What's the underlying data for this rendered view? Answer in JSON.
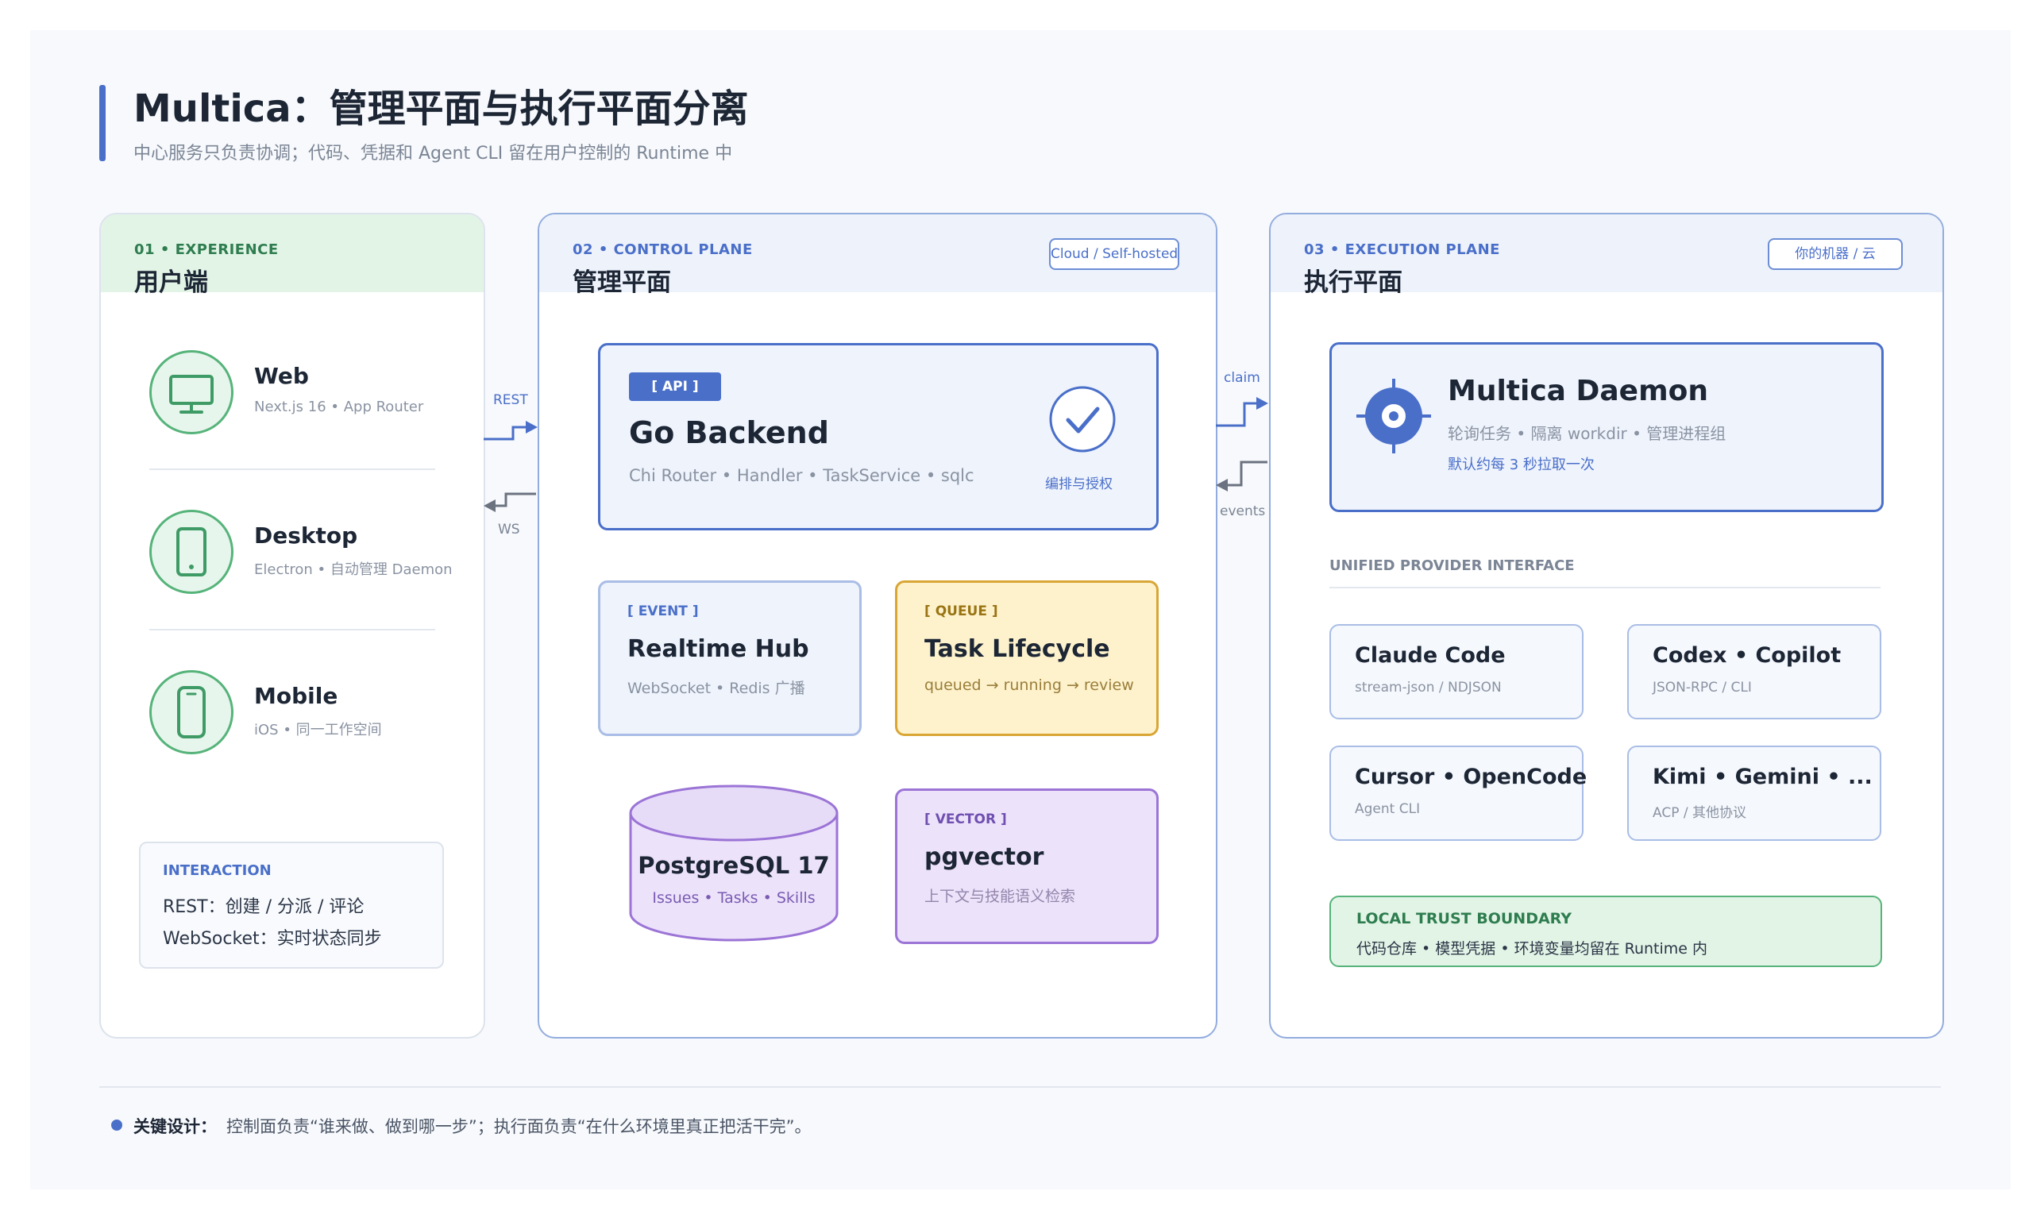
{
  "header": {
    "title": "Multica：管理平面与执行平面分离",
    "subtitle": "中心服务只负责协调；代码、凭据和 Agent CLI 留在用户控制的 Runtime 中"
  },
  "experience": {
    "tag": "01 • EXPERIENCE",
    "title": "用户端",
    "clients": [
      {
        "name": "Web",
        "desc": "Next.js 16 • App Router",
        "icon": "monitor-icon"
      },
      {
        "name": "Desktop",
        "desc": "Electron • 自动管理 Daemon",
        "icon": "tablet-icon"
      },
      {
        "name": "Mobile",
        "desc": "iOS • 同一工作空间",
        "icon": "phone-icon"
      }
    ],
    "interaction": {
      "label": "INTERACTION",
      "rows": [
        "REST：创建 / 分派 / 评论",
        "WebSocket：实时状态同步"
      ]
    }
  },
  "connectors": {
    "rest": "REST",
    "ws": "WS",
    "claim": "claim",
    "events": "events"
  },
  "control": {
    "tag": "02 • CONTROL PLANE",
    "title": "管理平面",
    "pill": "Cloud / Self-hosted",
    "api": {
      "tag": "[ API ]",
      "name": "Go Backend",
      "desc": "Chi Router • Handler • TaskService • sqlc",
      "check_label": "编排与授权"
    },
    "event": {
      "tag": "[ EVENT ]",
      "name": "Realtime Hub",
      "desc": "WebSocket • Redis 广播"
    },
    "queue": {
      "tag": "[ QUEUE ]",
      "name": "Task Lifecycle",
      "desc": "queued → running → review"
    },
    "db": {
      "name": "PostgreSQL 17",
      "desc": "Issues • Tasks • Skills"
    },
    "vector": {
      "tag": "[ VECTOR ]",
      "name": "pgvector",
      "desc": "上下文与技能语义检索"
    }
  },
  "execution": {
    "tag": "03 • EXECUTION PLANE",
    "title": "执行平面",
    "pill": "你的机器 / 云",
    "daemon": {
      "name": "Multica Daemon",
      "desc": "轮询任务 • 隔离 workdir • 管理进程组",
      "note": "默认约每 3 秒拉取一次"
    },
    "provider_label": "UNIFIED PROVIDER INTERFACE",
    "providers": [
      {
        "name": "Claude Code",
        "desc": "stream-json / NDJSON"
      },
      {
        "name": "Codex • Copilot",
        "desc": "JSON-RPC / CLI"
      },
      {
        "name": "Cursor • OpenCode",
        "desc": "Agent CLI"
      },
      {
        "name": "Kimi • Gemini • ...",
        "desc": "ACP / 其他协议"
      }
    ],
    "trust": {
      "label": "LOCAL TRUST BOUNDARY",
      "desc": "代码仓库 • 模型凭据 • 环境变量均留在 Runtime 内"
    }
  },
  "footer": {
    "key": "关键设计：",
    "text": "控制面负责“谁来做、做到哪一步”；执行面负责“在什么环境里真正把活干完”。"
  },
  "colors": {
    "accent_blue": "#4a6fc9",
    "green": "#56b37a",
    "queue_yellow": "#d9a634",
    "vector_purple": "#9b74d6"
  }
}
